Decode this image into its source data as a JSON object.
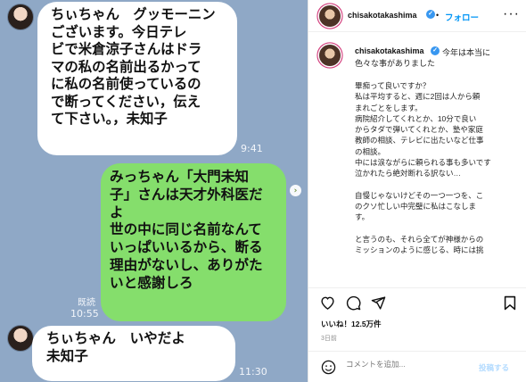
{
  "chat": {
    "messages": [
      {
        "lines": [
          "ちぃちゃん　グッモーニン",
          "ございます。今日テレ",
          "ビで米倉涼子さんはドラ",
          "マの私の名前出るかって",
          "に私の名前使っているの",
          "で断ってください，伝え",
          "て下さい。，未知子"
        ],
        "time": "9:41"
      },
      {
        "lines": [
          "みっちゃん「大門未知",
          "子」さんは天才外科医だ",
          "よ",
          "世の中に同じ名前なんて",
          "いっぱいいるから、断る",
          "理由がないし、ありがた",
          "いと感謝しろ"
        ],
        "read": "既読",
        "time": "10:55"
      },
      {
        "lines": [
          "ちぃちゃん　いやだよ",
          "未知子"
        ],
        "time": "11:30"
      }
    ]
  },
  "post": {
    "header_username": "chisakotakashima",
    "follow_label": "フォロー",
    "caption_username": "chisakotakashima",
    "caption_first": "今年は本当に",
    "caption_second": "色々な事がありました",
    "paragraphs": [
      [
        "畢痴って良いですか？",
        "私は平均すると、週に2回は人から頼",
        "まれごとをします。",
        "病院紹介してくれとか、10分で良い",
        "からタダで弾いてくれとか、塾や家庭",
        "教師の相談、テレビに出たいなど仕事",
        "の相談。",
        "中には涙ながらに頼られる事も多いです",
        "泣かれたら絶対断れる訳ない…"
      ],
      [
        "自慢じゃないけどその一つ一つを、こ",
        "のクソ忙しい中完璧に私はこなしま",
        "す。"
      ],
      [
        "と言うのも、それら全てが神様からの",
        "ミッションのように感じる、時には挑"
      ]
    ],
    "likes": "いいね！12.5万件",
    "age": "3日前",
    "comment_placeholder": "コメントを追加...",
    "post_label": "投稿する",
    "icons": [
      "heart-icon",
      "comment-icon",
      "share-icon",
      "bookmark-icon",
      "emoji-icon",
      "more-icon"
    ]
  }
}
